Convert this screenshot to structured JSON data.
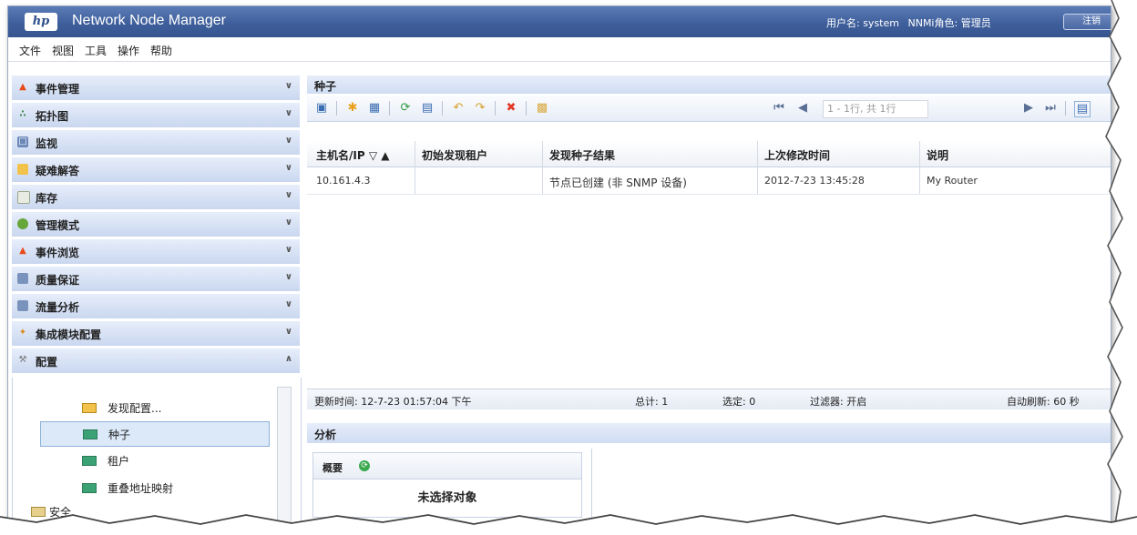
{
  "window": {
    "logo": "hp",
    "title": "Network Node Manager",
    "user_label": "用户名: system",
    "role_label": "NNMi角色: 管理员",
    "signout_label": "注销"
  },
  "menu": [
    "文件",
    "视图",
    "工具",
    "操作",
    "帮助"
  ],
  "sidebar": {
    "sections": [
      {
        "label": "事件管理",
        "icon": "flame-icon"
      },
      {
        "label": "拓扑图",
        "icon": "topology-icon"
      },
      {
        "label": "监视",
        "icon": "monitor-icon"
      },
      {
        "label": "疑难解答",
        "icon": "troubleshoot-icon"
      },
      {
        "label": "库存",
        "icon": "inventory-icon"
      },
      {
        "label": "管理模式",
        "icon": "management-mode-icon"
      },
      {
        "label": "事件浏览",
        "icon": "incident-browse-icon"
      },
      {
        "label": "质量保证",
        "icon": "quality-icon"
      },
      {
        "label": "流量分析",
        "icon": "traffic-icon"
      },
      {
        "label": "集成模块配置",
        "icon": "integration-icon"
      },
      {
        "label": "配置",
        "icon": "wrench-icon"
      }
    ],
    "config_items": [
      {
        "label": "发现配置..."
      },
      {
        "label": "种子"
      },
      {
        "label": "租户"
      },
      {
        "label": "重叠地址映射"
      },
      {
        "label": "安全"
      }
    ]
  },
  "seeds": {
    "title": "种子",
    "pager_text": "1 - 1行, 共 1行",
    "columns": [
      "主机名/IP",
      "初始发现租户",
      "发现种子结果",
      "上次修改时间",
      "说明"
    ],
    "rows": [
      {
        "host": "10.161.4.3",
        "tenant": "",
        "result": "节点已创建 (非 SNMP 设备)",
        "modified": "2012-7-23 13:45:28",
        "note": "My Router"
      }
    ],
    "status": {
      "updated": "更新时间: 12-7-23 01:57:04 下午",
      "total": "总计: 1",
      "selected": "选定: 0",
      "filter": "过滤器: 开启",
      "autorefresh": "自动刷新: 60 秒"
    }
  },
  "analysis": {
    "title": "分析",
    "summary_title": "概要",
    "no_selection": "未选择对象"
  },
  "colors": {
    "title_bar": "#3f5f9c",
    "accordion": "#c9d7ef",
    "selected": "#dbe9f9"
  }
}
